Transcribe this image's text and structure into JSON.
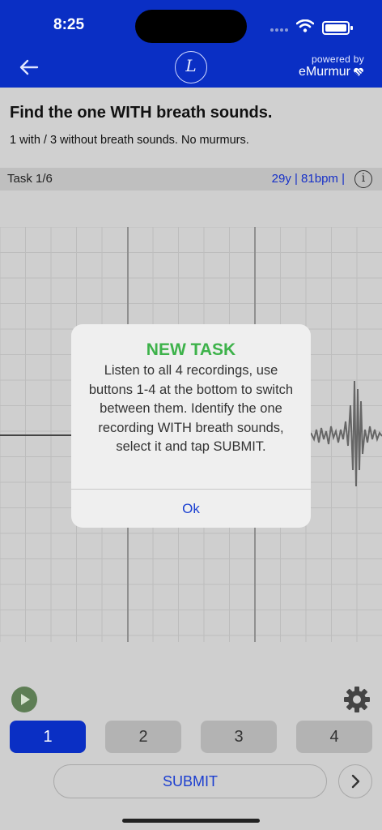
{
  "status_bar": {
    "time": "8:25"
  },
  "header": {
    "logo_letter": "L",
    "powered_by": "powered by",
    "brand": "eMurmur"
  },
  "task": {
    "title": "Find the one WITH breath sounds.",
    "subtitle": "1 with / 3 without breath sounds. No murmurs.",
    "progress_label": "Task 1/6",
    "patient_info": "29y | 81bpm |"
  },
  "dialog": {
    "title": "NEW TASK",
    "message": "Listen to all 4 recordings, use buttons 1-4 at the bottom to switch between them. Identify the one recording WITH breath sounds, select it and tap SUBMIT.",
    "ok_label": "Ok"
  },
  "recordings": {
    "buttons": [
      "1",
      "2",
      "3",
      "4"
    ],
    "selected": "1"
  },
  "actions": {
    "submit_label": "SUBMIT"
  },
  "icons": {
    "back": "back-arrow-icon",
    "play": "play-icon",
    "settings": "gear-icon",
    "info": "info-icon",
    "next": "chevron-right-icon"
  },
  "colors": {
    "brand_blue": "#0a2fc4",
    "dialog_title": "#3db24a",
    "link_blue": "#1b40d1",
    "play_green": "#5e7e55"
  }
}
